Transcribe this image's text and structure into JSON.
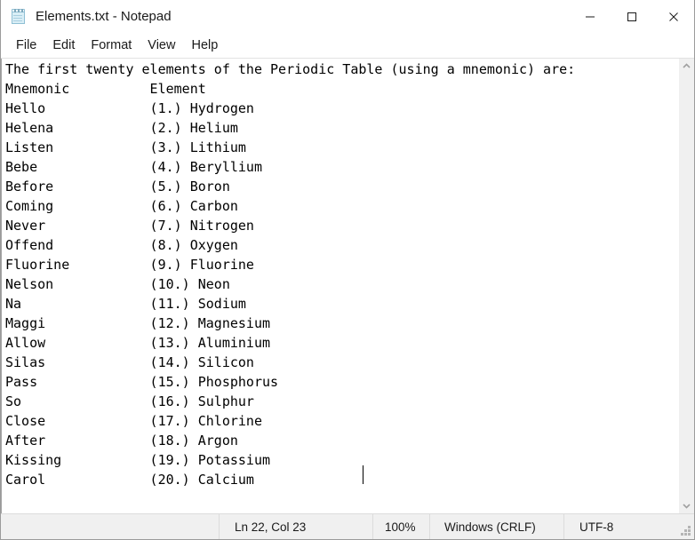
{
  "window": {
    "title": "Elements.txt - Notepad",
    "icon": "notepad-icon",
    "controls": {
      "minimize": "minimize-icon",
      "maximize": "maximize-icon",
      "close": "close-icon"
    }
  },
  "menubar": {
    "items": [
      {
        "label": "File"
      },
      {
        "label": "Edit"
      },
      {
        "label": "Format"
      },
      {
        "label": "View"
      },
      {
        "label": "Help"
      }
    ]
  },
  "document": {
    "heading": "The first twenty elements of the Periodic Table (using a mnemonic) are:",
    "column_headers": {
      "mnemonic": "Mnemonic",
      "element": "Element"
    },
    "rows": [
      {
        "mnemonic": "Hello",
        "number": "(1.)",
        "element": "Hydrogen"
      },
      {
        "mnemonic": "Helena",
        "number": "(2.)",
        "element": "Helium"
      },
      {
        "mnemonic": "Listen",
        "number": "(3.)",
        "element": "Lithium"
      },
      {
        "mnemonic": "Bebe",
        "number": "(4.)",
        "element": "Beryllium"
      },
      {
        "mnemonic": "Before",
        "number": "(5.)",
        "element": "Boron"
      },
      {
        "mnemonic": "Coming",
        "number": "(6.)",
        "element": "Carbon"
      },
      {
        "mnemonic": "Never",
        "number": "(7.)",
        "element": "Nitrogen"
      },
      {
        "mnemonic": "Offend",
        "number": "(8.)",
        "element": "Oxygen"
      },
      {
        "mnemonic": "Fluorine",
        "number": "(9.)",
        "element": "Fluorine"
      },
      {
        "mnemonic": "Nelson",
        "number": "(10.)",
        "element": "Neon"
      },
      {
        "mnemonic": "Na",
        "number": "(11.)",
        "element": "Sodium"
      },
      {
        "mnemonic": "Maggi",
        "number": "(12.)",
        "element": "Magnesium"
      },
      {
        "mnemonic": "Allow",
        "number": "(13.)",
        "element": "Aluminium"
      },
      {
        "mnemonic": "Silas",
        "number": "(14.)",
        "element": "Silicon"
      },
      {
        "mnemonic": "Pass",
        "number": "(15.)",
        "element": "Phosphorus"
      },
      {
        "mnemonic": "So",
        "number": "(16.)",
        "element": "Sulphur"
      },
      {
        "mnemonic": "Close",
        "number": "(17.)",
        "element": "Chlorine"
      },
      {
        "mnemonic": "After",
        "number": "(18.)",
        "element": "Argon"
      },
      {
        "mnemonic": "Kissing",
        "number": "(19.)",
        "element": "Potassium"
      },
      {
        "mnemonic": "Carol",
        "number": "(20.)",
        "element": "Calcium"
      }
    ],
    "text": "The first twenty elements of the Periodic Table (using a mnemonic) are:\nMnemonic          Element\nHello             (1.) Hydrogen\nHelena            (2.) Helium\nListen            (3.) Lithium\nBebe              (4.) Beryllium\nBefore            (5.) Boron\nComing            (6.) Carbon\nNever             (7.) Nitrogen\nOffend            (8.) Oxygen\nFluorine          (9.) Fluorine\nNelson            (10.) Neon\nNa                (11.) Sodium\nMaggi             (12.) Magnesium\nAllow             (13.) Aluminium\nSilas             (14.) Silicon\nPass              (15.) Phosphorus\nSo                (16.) Sulphur\nClose             (17.) Chlorine\nAfter             (18.) Argon\nKissing           (19.) Potassium\nCarol             (20.) Calcium"
  },
  "scrollbar": {
    "up_arrow": "chevron-up-icon",
    "down_arrow": "chevron-down-icon"
  },
  "statusbar": {
    "position": "Ln 22, Col 23",
    "zoom": "100%",
    "line_ending": "Windows (CRLF)",
    "encoding": "UTF-8"
  },
  "colors": {
    "window_background": "#ffffff",
    "statusbar_background": "#f0f0f0",
    "border": "#9b9b9b",
    "text": "#000000",
    "scrollbar_track": "#f0f0f0",
    "icon_accent": "#d9eef6"
  }
}
